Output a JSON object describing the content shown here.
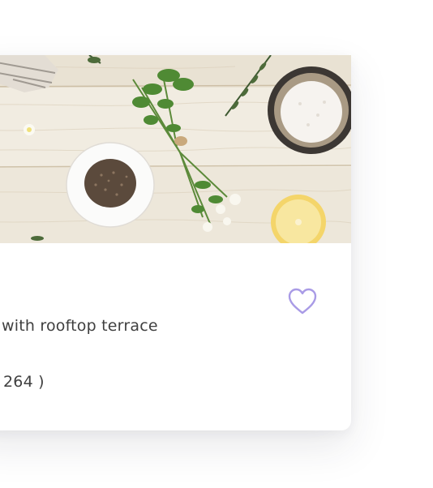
{
  "card": {
    "title": "with rooftop terrace",
    "reviews": "264 )",
    "favorite_icon": "heart-outline-icon",
    "image_subject": "herbs-and-spices-on-wooden-table"
  },
  "colors": {
    "heart_stroke": "#a99be6",
    "text": "#3f3f3f",
    "card_background": "#ffffff",
    "wood": "#ece6d8"
  }
}
